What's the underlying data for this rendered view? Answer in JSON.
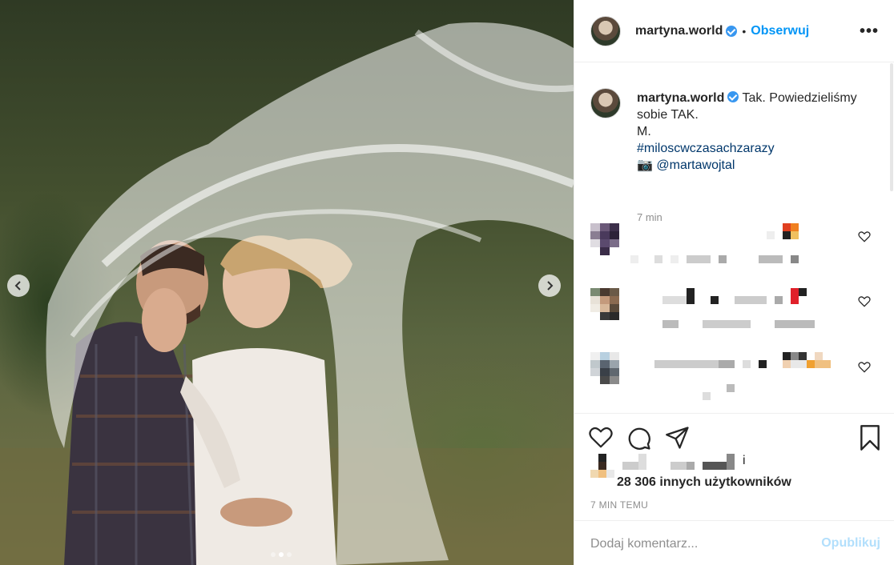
{
  "post": {
    "username": "martyna.world",
    "bullet": "•",
    "follow_label": "Obserwuj",
    "more_label": "•••"
  },
  "caption": {
    "username": "martyna.world",
    "text_line1": "Tak. Powiedzieliśmy sobie TAK.",
    "text_line2": "M.",
    "hashtag": "#miloscwczasachzarazy",
    "camera_emoji": "📷",
    "mention": "@martawojtal",
    "time": "7 min"
  },
  "likes": {
    "count_text": "28 306 innych użytkowników",
    "suffix_char": "i"
  },
  "posted_time": "7 MIN TEMU",
  "comment_box": {
    "placeholder": "Dodaj komentarz...",
    "publish_label": "Opublikuj"
  },
  "carousel": {
    "slides": 3,
    "active": 1
  },
  "colors": {
    "accent": "#0095f6",
    "publish_disabled": "#b2dffc",
    "verified": "#3897f0",
    "muted": "#8e8e8e",
    "link": "#00376b"
  },
  "icons": [
    "chevron-left-icon",
    "chevron-right-icon",
    "more-icon",
    "verified-icon",
    "heart-icon",
    "comment-icon",
    "share-icon",
    "bookmark-icon"
  ]
}
